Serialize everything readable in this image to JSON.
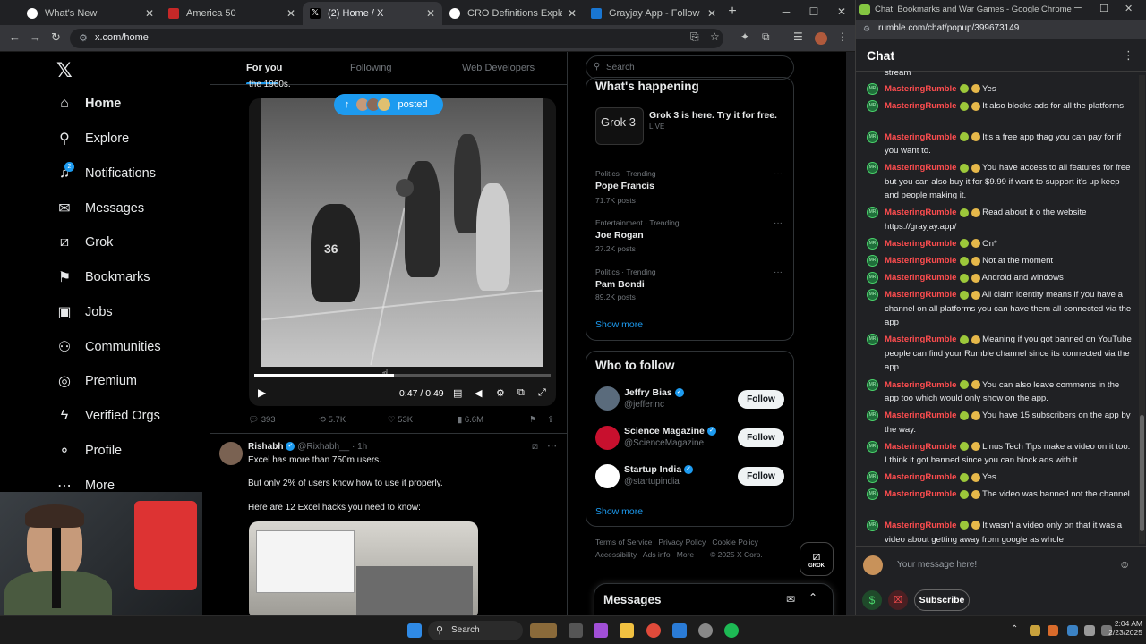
{
  "left_browser": {
    "tabs": [
      {
        "title": "What's New",
        "active": false
      },
      {
        "title": "America 50",
        "active": false
      },
      {
        "title": "(2) Home / X",
        "active": true
      },
      {
        "title": "CRO Definitions Explained",
        "active": false
      },
      {
        "title": "Grayjay App - Follow Creators",
        "active": false
      }
    ],
    "new_tab_glyph": "+",
    "url": "x.com/home"
  },
  "x": {
    "nav": [
      {
        "label": "Home",
        "icon": "home-icon",
        "glyph": "⌂"
      },
      {
        "label": "Explore",
        "icon": "search-icon",
        "glyph": "⚲"
      },
      {
        "label": "Notifications",
        "icon": "bell-icon",
        "glyph": "🔔︎",
        "badge": "2"
      },
      {
        "label": "Messages",
        "icon": "mail-icon",
        "glyph": "✉"
      },
      {
        "label": "Grok",
        "icon": "grok-icon",
        "glyph": "⧄"
      },
      {
        "label": "Bookmarks",
        "icon": "bookmark-icon",
        "glyph": "⚑"
      },
      {
        "label": "Jobs",
        "icon": "briefcase-icon",
        "glyph": "▣"
      },
      {
        "label": "Communities",
        "icon": "people-icon",
        "glyph": "⚇"
      },
      {
        "label": "Premium",
        "icon": "premium-icon",
        "glyph": "◎"
      },
      {
        "label": "Verified Orgs",
        "icon": "lightning-icon",
        "glyph": "ϟ"
      },
      {
        "label": "Profile",
        "icon": "user-icon",
        "glyph": "⚬"
      },
      {
        "label": "More",
        "icon": "more-icon",
        "glyph": "⋯"
      }
    ],
    "feed_tabs": [
      "For you",
      "Following",
      "Web Developers"
    ],
    "prev_text_tail": "the 1960s.",
    "posted_pill": "posted",
    "video": {
      "time": "0:47 / 0:49",
      "progress": 0.47
    },
    "post1_stats": {
      "replies": "393",
      "reposts": "5.7K",
      "likes": "53K",
      "views": "6.6M"
    },
    "post2": {
      "name": "Rishabh",
      "handle": "@Rixhabh__ · 1h",
      "line1": "Excel has more than 750m users.",
      "line2": "But only 2% of users know how to use it properly.",
      "line3": "Here are 12 Excel hacks you need to know:"
    },
    "search_placeholder": "Search",
    "whats_happening": {
      "title": "What's happening",
      "promo_title": "Grok 3 is here. Try it for free.",
      "promo_live": "LIVE",
      "promo_img_text": "Grok 3",
      "trends": [
        {
          "meta": "Politics · Trending",
          "name": "Pope Francis",
          "posts": "71.7K posts"
        },
        {
          "meta": "Entertainment · Trending",
          "name": "Joe Rogan",
          "posts": "27.2K posts"
        },
        {
          "meta": "Politics · Trending",
          "name": "Pam Bondi",
          "posts": "89.2K posts"
        }
      ],
      "show_more": "Show more"
    },
    "who_to_follow": {
      "title": "Who to follow",
      "users": [
        {
          "name": "Jeffry Bias",
          "handle": "@jefferinc",
          "button": "Follow"
        },
        {
          "name": "Science Magazine",
          "handle": "@ScienceMagazine",
          "button": "Follow"
        },
        {
          "name": "Startup India",
          "handle": "@startupindia",
          "button": "Follow"
        }
      ],
      "show_more": "Show more"
    },
    "footer_links": [
      "Terms of Service",
      "Privacy Policy",
      "Cookie Policy",
      "Accessibility",
      "Ads info",
      "More ···",
      "© 2025 X Corp."
    ],
    "messages_label": "Messages",
    "grok_label": "GROK"
  },
  "right_browser": {
    "window_title": "Chat: Bookmarks and War Games - Google Chrome",
    "url": "rumble.com/chat/popup/399673149",
    "chat_title": "Chat",
    "top_fragment": "stream",
    "messages": [
      {
        "user": "MasteringRumble",
        "text": "Yes"
      },
      {
        "user": "MasteringRumble",
        "text": "It also blocks ads for all the platforms"
      },
      {
        "user": "MasteringRumble",
        "text": "It's a free app thag you can pay for if you want to."
      },
      {
        "user": "MasteringRumble",
        "text": "You have access to all features for free but you can also buy it for $9.99 if want to support it's up keep and people making it."
      },
      {
        "user": "MasteringRumble",
        "text": "Read about it o the website",
        "link": "https://grayjay.app/"
      },
      {
        "user": "MasteringRumble",
        "text": "On*"
      },
      {
        "user": "MasteringRumble",
        "text": "Not at the moment"
      },
      {
        "user": "MasteringRumble",
        "text": "Android and windows"
      },
      {
        "user": "MasteringRumble",
        "text": "All claim identity means if you have a channel on all platforms you can have them all connected via the app"
      },
      {
        "user": "MasteringRumble",
        "text": "Meaning if you got banned on YouTube people can find your Rumble channel since its connected via the app"
      },
      {
        "user": "MasteringRumble",
        "text": "You can also leave comments in the app too which would only show on the app."
      },
      {
        "user": "MasteringRumble",
        "text": "You have 15 subscribers on the app by the way."
      },
      {
        "user": "MasteringRumble",
        "text": "Linus Tech Tips make a video on it too. I think it got banned since you can block ads with it."
      },
      {
        "user": "MasteringRumble",
        "text": "Yes"
      },
      {
        "user": "MasteringRumble",
        "text": "The video was banned not the channel"
      },
      {
        "user": "MasteringRumble",
        "text": "It wasn't a video only on that it was a video about getting away from google as whole"
      }
    ],
    "input_placeholder": "Your message here!",
    "subscribe_label": "Subscribe"
  },
  "taskbar": {
    "search_label": "Search",
    "time": "2:04 AM",
    "date": "2/23/2025"
  },
  "colors": {
    "x_blue": "#1d9bf0",
    "rumble_red": "#ff4d4f",
    "rumble_green": "#4ad36b"
  }
}
